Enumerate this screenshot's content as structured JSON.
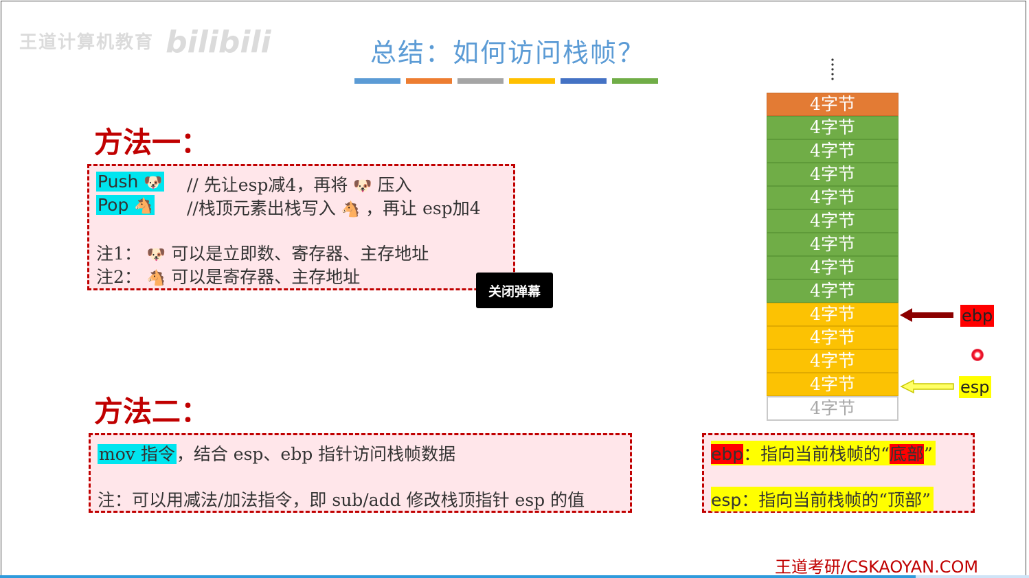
{
  "watermark": {
    "text": "王道计算机教育",
    "logo": "bilibili"
  },
  "title": "总结：如何访问栈帧？",
  "title_bar_colors": [
    "#5b9bd5",
    "#ed7d31",
    "#a5a5a5",
    "#ffc000",
    "#4472c4",
    "#70ad47"
  ],
  "method1": {
    "heading": "方法一：",
    "push_label": "Push",
    "push_emoji": "🐶",
    "push_comment_a": "// 先让esp减4，再将",
    "push_comment_b": "压入",
    "pop_label": "Pop",
    "pop_emoji": "🐴",
    "pop_comment_a": "//栈顶元素出栈写入",
    "pop_comment_b": "，再让 esp加4",
    "note1_prefix": "注1：",
    "note1_text": "可以是立即数、寄存器、主存地址",
    "note2_prefix": "注2：",
    "note2_text": "可以是寄存器、主存地址"
  },
  "close_danmaku_button": "关闭弹幕",
  "method2": {
    "heading": "方法二：",
    "mov_label": "mov 指令",
    "mov_text": "，结合 esp、ebp 指针访问栈帧数据",
    "note": "注：可以用减法/加法指令，即 sub/add 修改栈顶指针 esp 的值"
  },
  "stack": {
    "cells": [
      {
        "label": "4字节",
        "color": "orange"
      },
      {
        "label": "4字节",
        "color": "green"
      },
      {
        "label": "4字节",
        "color": "green"
      },
      {
        "label": "4字节",
        "color": "green"
      },
      {
        "label": "4字节",
        "color": "green"
      },
      {
        "label": "4字节",
        "color": "green"
      },
      {
        "label": "4字节",
        "color": "green"
      },
      {
        "label": "4字节",
        "color": "green"
      },
      {
        "label": "4字节",
        "color": "green"
      },
      {
        "label": "4字节",
        "color": "yellow"
      },
      {
        "label": "4字节",
        "color": "yellow"
      },
      {
        "label": "4字节",
        "color": "yellow"
      },
      {
        "label": "4字节",
        "color": "yellow"
      },
      {
        "label": "4字节",
        "color": "white"
      }
    ],
    "ebp_label": "ebp",
    "esp_label": "esp"
  },
  "pointer_notes": {
    "ebp_name": "ebp",
    "ebp_text": "：指向当前栈帧的“",
    "ebp_highlight": "底部",
    "ebp_close": "”",
    "esp_name": "esp",
    "esp_text": "：指向当前栈帧的“顶部”"
  },
  "progress": 0.89,
  "footer": "王道考研/CSKAOYAN.COM"
}
